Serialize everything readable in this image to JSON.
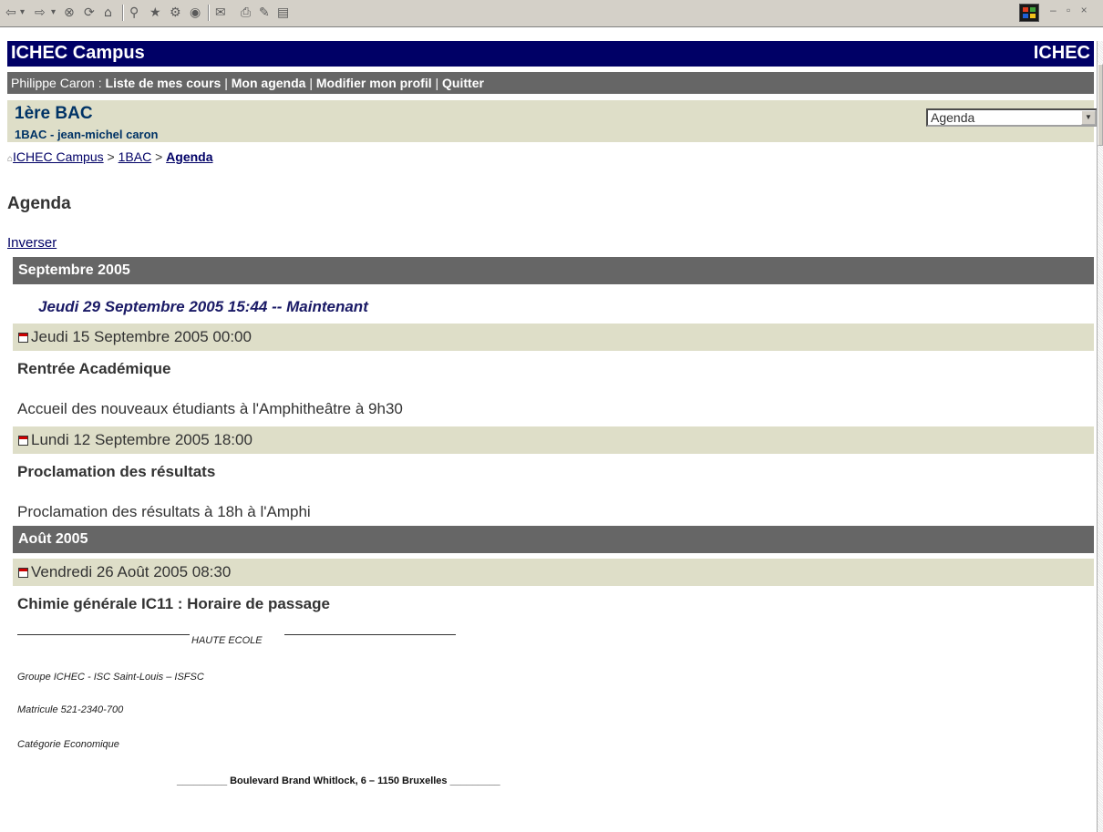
{
  "toolbar": {
    "buttons": [
      {
        "name": "back-icon",
        "glyph": "⇦"
      },
      {
        "name": "back-dropdown-icon",
        "glyph": "▾"
      },
      {
        "name": "forward-icon",
        "glyph": "⇨"
      },
      {
        "name": "forward-dropdown-icon",
        "glyph": "▾"
      },
      {
        "name": "stop-icon",
        "glyph": "⊗"
      },
      {
        "name": "refresh-icon",
        "glyph": "⟳"
      },
      {
        "name": "home-icon",
        "glyph": "⌂"
      },
      {
        "name": "search-icon",
        "glyph": "⚲"
      },
      {
        "name": "favorites-icon",
        "glyph": "★"
      },
      {
        "name": "history-icon",
        "glyph": "⚙"
      },
      {
        "name": "media-icon",
        "glyph": "◉"
      },
      {
        "name": "mail-icon",
        "glyph": "✉"
      },
      {
        "name": "print-icon",
        "glyph": "⎙"
      },
      {
        "name": "edit-icon",
        "glyph": "✎"
      },
      {
        "name": "discuss-icon",
        "glyph": "▤"
      }
    ],
    "window_controls": "– ▫ ×"
  },
  "header": {
    "title": "ICHEC Campus",
    "brand": "ICHEC"
  },
  "userbar": {
    "user": "Philippe Caron : ",
    "links": [
      "Liste de mes cours",
      "Mon agenda",
      "Modifier mon profil",
      "Quitter"
    ],
    "separator": " | "
  },
  "course": {
    "title": "1ère BAC",
    "subtitle": "1BAC - jean-michel caron",
    "tool_select": "Agenda"
  },
  "breadcrumb": {
    "home": "ICHEC Campus",
    "course": "1BAC",
    "current": "Agenda",
    "sep": " > "
  },
  "page": {
    "title": "Agenda",
    "invert_link": "Inverser"
  },
  "months": [
    "Septembre 2005",
    "Août 2005"
  ],
  "now_line": "Jeudi 29 Septembre 2005 15:44 -- Maintenant",
  "events": [
    {
      "date": "Jeudi 15 Septembre 2005 00:00",
      "title": "Rentrée Académique",
      "desc": "Accueil des nouveaux étudiants à l'Amphitheâtre à 9h30"
    },
    {
      "date": "Lundi 12 Septembre 2005 18:00",
      "title": "Proclamation des résultats",
      "desc": "Proclamation des résultats à 18h à l'Amphi"
    },
    {
      "date": "Vendredi 26 Août 2005 08:30",
      "title": "Chimie générale IC11 : Horaire de passage",
      "desc": ""
    }
  ],
  "letterhead": {
    "haute": "HAUTE ECOLE",
    "groupe": "Groupe ICHEC - ISC Saint-Louis – ISFSC",
    "matricule": "Matricule 521-2340-700",
    "categorie": "Catégorie Economique",
    "address": "_________ Boulevard Brand Whitlock, 6 – 1150 Bruxelles _________"
  }
}
